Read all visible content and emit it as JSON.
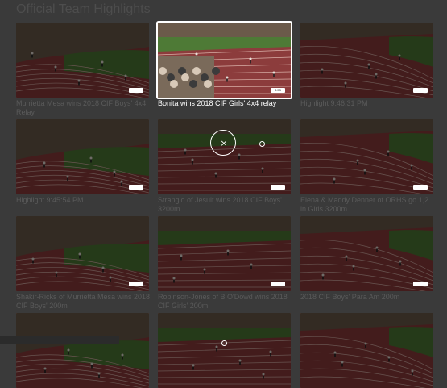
{
  "page": {
    "title": "Official Team Highlights"
  },
  "videos": [
    {
      "caption": "Murrietta Mesa wins 2018 CIF Boys' 4x4 Relay",
      "badge": "",
      "selected": false
    },
    {
      "caption": "Bonita wins 2018 CIF Girls' 4x4 relay",
      "badge": "3:53",
      "selected": true
    },
    {
      "caption": "Highlight 9:46:31 PM",
      "badge": "",
      "selected": false
    },
    {
      "caption": "Highlight 9:45:54 PM",
      "badge": "",
      "selected": false
    },
    {
      "caption": "Strangio of Jesuit wins 2018 CIF Boys' 3200m",
      "badge": "",
      "selected": false
    },
    {
      "caption": "Elena & Maddy Denner of ORHS go 1,2 in Girls 3200m",
      "badge": "",
      "selected": false
    },
    {
      "caption": "Shakir-Ricks of Murrietta Mesa wins 2018 CIF Boys' 200m",
      "badge": "",
      "selected": false
    },
    {
      "caption": "Robinson-Jones of B O'Dowd wins 2018 CIF Girls' 200m",
      "badge": "",
      "selected": false
    },
    {
      "caption": "2018 CIF Boys' Para Am 200m",
      "badge": "",
      "selected": false
    },
    {
      "caption": "",
      "badge": "",
      "selected": false
    },
    {
      "caption": "",
      "badge": "",
      "selected": false
    },
    {
      "caption": "",
      "badge": "",
      "selected": false
    }
  ],
  "colors": {
    "track": "#8c3c3c",
    "lane_line": "#d9b0a8",
    "grass": "#4e7a36",
    "stands": "#6b5a4a",
    "highlight": "#ffffff",
    "background": "#3a3a3a"
  },
  "icons": {
    "close": "close-icon",
    "scrub": "scrub-handle-icon"
  }
}
